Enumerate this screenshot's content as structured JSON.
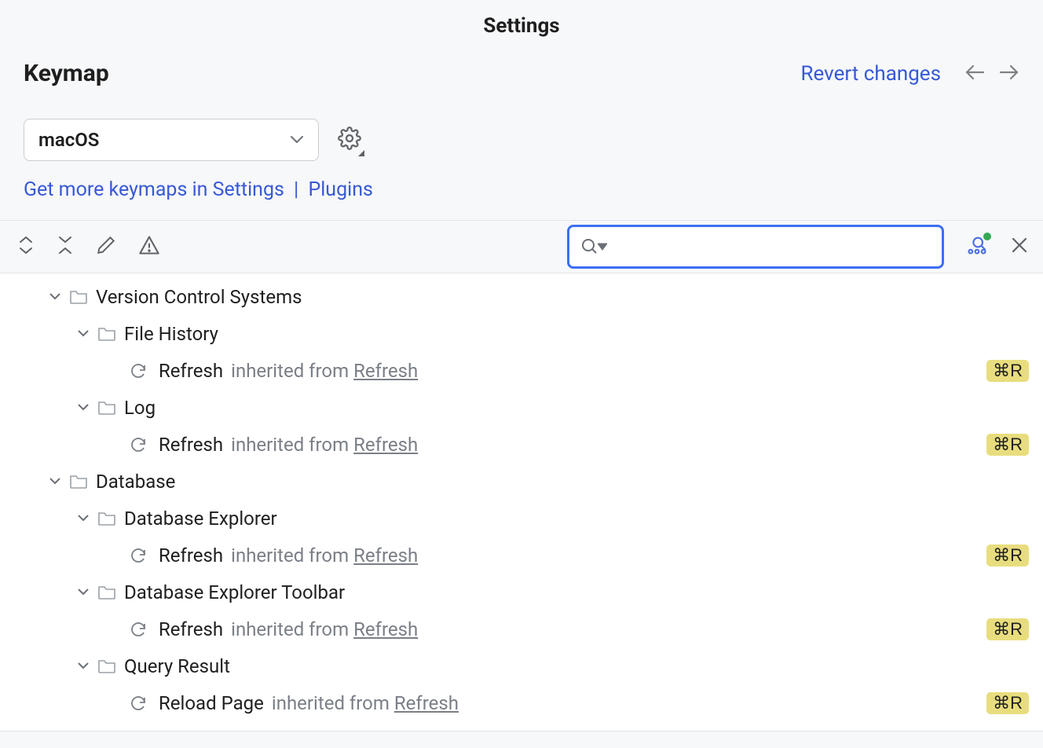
{
  "window": {
    "title": "Settings"
  },
  "page": {
    "heading": "Keymap",
    "revert_label": "Revert changes",
    "keymap_selected": "macOS",
    "more_keymaps_text": "Get more keymaps in Settings",
    "plugins_text": "Plugins"
  },
  "toolbar": {
    "search_placeholder": ""
  },
  "tree": [
    {
      "label": "Version Control Systems",
      "expanded": true,
      "children": [
        {
          "label": "File History",
          "expanded": true,
          "children": [
            {
              "action": "Refresh",
              "inherit_prefix": "inherited from",
              "inherit_link": "Refresh",
              "shortcut": "⌘R"
            }
          ]
        },
        {
          "label": "Log",
          "expanded": true,
          "children": [
            {
              "action": "Refresh",
              "inherit_prefix": "inherited from",
              "inherit_link": "Refresh",
              "shortcut": "⌘R"
            }
          ]
        }
      ]
    },
    {
      "label": "Database",
      "expanded": true,
      "children": [
        {
          "label": "Database Explorer",
          "expanded": true,
          "children": [
            {
              "action": "Refresh",
              "inherit_prefix": "inherited from",
              "inherit_link": "Refresh",
              "shortcut": "⌘R"
            }
          ]
        },
        {
          "label": "Database Explorer Toolbar",
          "expanded": true,
          "children": [
            {
              "action": "Refresh",
              "inherit_prefix": "inherited from",
              "inherit_link": "Refresh",
              "shortcut": "⌘R"
            }
          ]
        },
        {
          "label": "Query Result",
          "expanded": true,
          "children": [
            {
              "action": "Reload Page",
              "inherit_prefix": "inherited from",
              "inherit_link": "Refresh",
              "shortcut": "⌘R"
            }
          ]
        }
      ]
    }
  ]
}
